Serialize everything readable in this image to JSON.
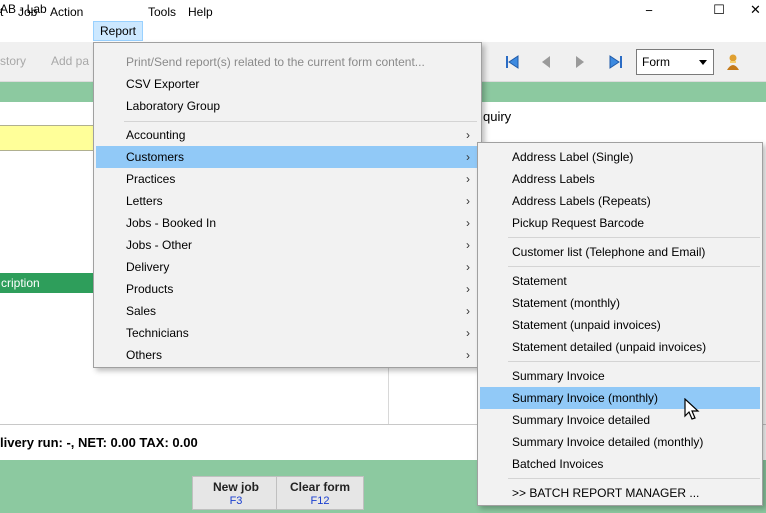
{
  "window": {
    "title": "AB  - Lab",
    "minimize_glyph": "−",
    "maximize_glyph": "☐",
    "close_glyph": "✕"
  },
  "menubar": {
    "items": [
      {
        "label": "t"
      },
      {
        "label": "Job"
      },
      {
        "label": "Action"
      },
      {
        "label": "Report"
      },
      {
        "label": "Tools"
      },
      {
        "label": "Help"
      }
    ]
  },
  "toolbar": {
    "history_label": "story",
    "add_label": "Add pa",
    "form_select": "Form"
  },
  "main": {
    "enquiry_label": "quiry",
    "description_header": "cription",
    "summary": "livery run: -,   NET: 0.00   TAX: 0.00"
  },
  "footer": {
    "new_job": {
      "label": "New job",
      "key": "F3"
    },
    "clear_form": {
      "label": "Clear form",
      "key": "F12"
    }
  },
  "report_menu": {
    "items": [
      {
        "label": "Print/Send report(s) related to the current form content..."
      },
      {
        "label": "CSV Exporter"
      },
      {
        "label": "Laboratory Group"
      },
      {
        "label": "Accounting"
      },
      {
        "label": "Customers"
      },
      {
        "label": "Practices"
      },
      {
        "label": "Letters"
      },
      {
        "label": "Jobs - Booked In"
      },
      {
        "label": "Jobs - Other"
      },
      {
        "label": "Delivery"
      },
      {
        "label": "Products"
      },
      {
        "label": "Sales"
      },
      {
        "label": "Technicians"
      },
      {
        "label": "Others"
      }
    ],
    "submenu_arrow": "›"
  },
  "customers_menu": {
    "items": [
      {
        "label": "Address Label (Single)"
      },
      {
        "label": "Address Labels"
      },
      {
        "label": "Address Labels (Repeats)"
      },
      {
        "label": "Pickup Request Barcode"
      },
      {
        "label": "Customer list (Telephone and Email)"
      },
      {
        "label": "Statement"
      },
      {
        "label": "Statement (monthly)"
      },
      {
        "label": "Statement (unpaid invoices)"
      },
      {
        "label": "Statement detailed (unpaid invoices)"
      },
      {
        "label": "Summary Invoice"
      },
      {
        "label": "Summary Invoice (monthly)"
      },
      {
        "label": "Summary Invoice detailed"
      },
      {
        "label": "Summary Invoice detailed (monthly)"
      },
      {
        "label": "Batched Invoices"
      },
      {
        "label": ">> BATCH REPORT MANAGER ..."
      }
    ]
  },
  "colors": {
    "green_band": "#8cc9a0",
    "header_green": "#2e9e5b",
    "highlight": "#91c9f7",
    "yellow_field": "#ffff99"
  }
}
